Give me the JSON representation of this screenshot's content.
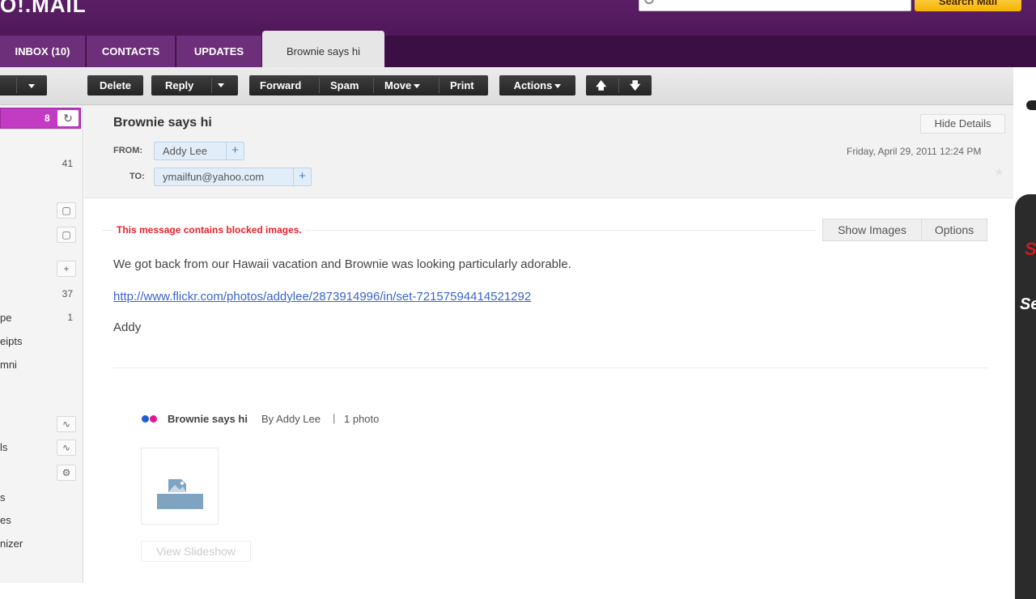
{
  "header": {
    "logo": "O!.MAIL",
    "search_button": "Search Mail"
  },
  "tabs": [
    {
      "label": "INBOX (10)"
    },
    {
      "label": "CONTACTS"
    },
    {
      "label": "UPDATES"
    },
    {
      "label": "Brownie says hi"
    }
  ],
  "toolbar": {
    "delete": "Delete",
    "reply": "Reply",
    "forward": "Forward",
    "spam": "Spam",
    "move": "Move",
    "print": "Print",
    "actions": "Actions",
    "up_icon": "arrow-up-icon",
    "down_icon": "arrow-down-icon"
  },
  "sidebar": {
    "inbox_count": "8",
    "numbers": [
      "41",
      "37",
      "1"
    ],
    "labels": [
      "pe",
      "eipts",
      "mni",
      "ls",
      "s",
      "es",
      "nizer"
    ]
  },
  "message": {
    "subject": "Brownie says hi",
    "from_label": "FROM:",
    "from": "Addy Lee",
    "to_label": "TO:",
    "to": "ymailfun@yahoo.com",
    "hide_details": "Hide Details",
    "date": "Friday, April 29, 2011 12:24 PM",
    "blocked_notice": "This message contains blocked images.",
    "show_images": "Show Images",
    "options": "Options",
    "body": "We got back from our Hawaii vacation and Brownie was looking particularly adorable.",
    "link": "http://www.flickr.com/photos/addylee/2873914996/in/set-72157594414521292",
    "signature": "Addy"
  },
  "flickr": {
    "title": "Brownie says hi",
    "by": "By Addy Lee",
    "separator": "|",
    "count": "1 photo",
    "slideshow": "View Slideshow"
  },
  "colors": {
    "header": "#5b1e66",
    "tab_bar": "#3b0f44",
    "tab": "#6e2f7a",
    "inbox_highlight": "#c13cc3",
    "search_button": "#f5b400",
    "blocked_text": "#e8212d",
    "link": "#3b66c8"
  }
}
